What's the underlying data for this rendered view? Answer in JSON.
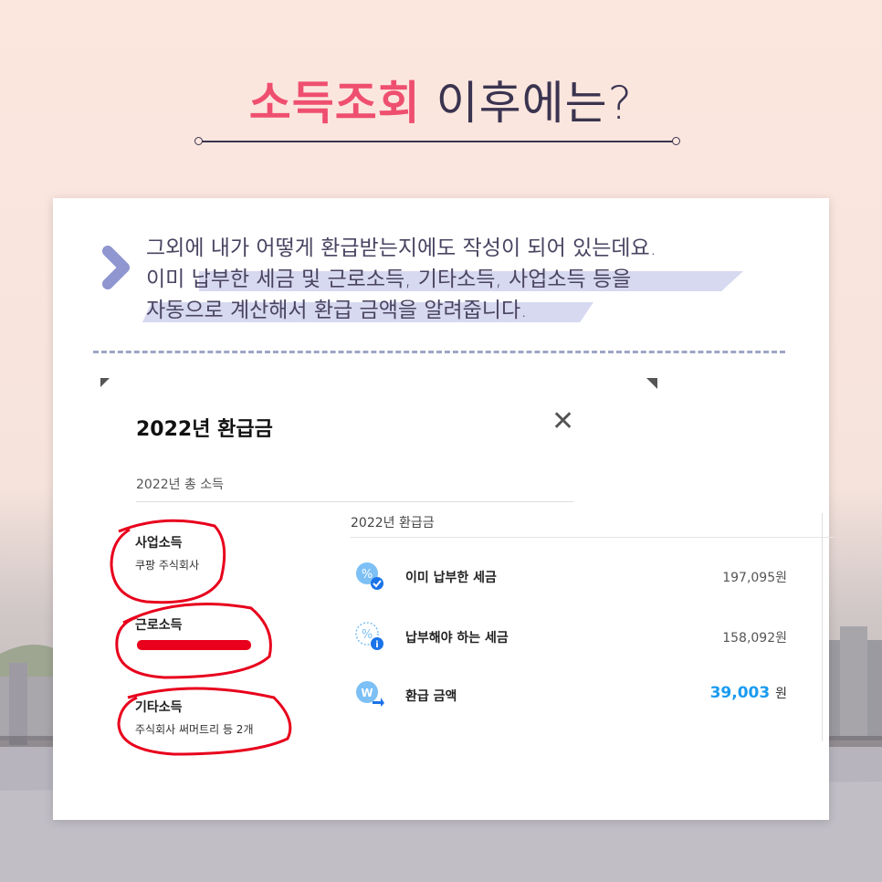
{
  "header": {
    "title_highlight": "소득조회",
    "title_rest": " 이후에는?"
  },
  "intro": {
    "line1": "그외에 내가 어떻게 환급받는지에도 작성이 되어 있는데요.",
    "line2": "이미 납부한 세금 및 근로소득, 기타소득, 사업소득 등을",
    "line3": "자동으로 계산해서 환급 금액을 알려줍니다."
  },
  "modal": {
    "title": "2022년 환급금",
    "total_label": "2022년 총 소득",
    "income": [
      {
        "name": "사업소득",
        "detail": "쿠팡 주식회사"
      },
      {
        "name": "근로소득",
        "detail": ""
      },
      {
        "name": "기타소득",
        "detail": "주식회사 써머트리 등 2개"
      }
    ],
    "refund": {
      "heading": "2022년 환급금",
      "rows": [
        {
          "label": "이미 납부한 세금",
          "amount": "197,095원",
          "icon": "percent-check-icon"
        },
        {
          "label": "납부해야 하는 세금",
          "amount": "158,092원",
          "icon": "percent-info-icon"
        },
        {
          "label": "환급 금액",
          "amount": "39,003",
          "unit": "원",
          "icon": "refund-won-icon"
        }
      ]
    }
  },
  "colors": {
    "accent_pink": "#ef4f6f",
    "navy": "#3b3450",
    "refund_blue": "#1a9bf0",
    "marker_red": "#e8001c"
  }
}
